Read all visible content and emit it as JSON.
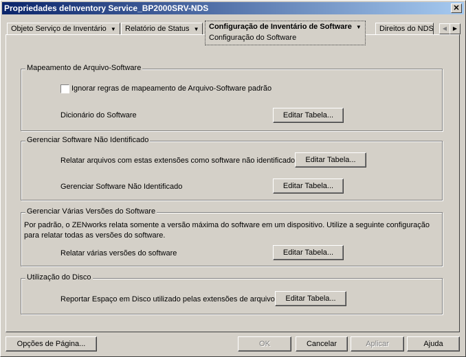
{
  "window": {
    "title": "Propriedades deInventory Service_BP2000SRV-NDS",
    "close": "✕"
  },
  "tabs": [
    {
      "label": "Objeto Serviço de Inventário"
    },
    {
      "label": "Relatório de Status"
    },
    {
      "label": "Configuração de Inventário de Software",
      "sub": "Configuração do Software"
    },
    {
      "label": "Direitos do NDS"
    }
  ],
  "tab_scroll": {
    "left": "◀",
    "right": "▶"
  },
  "dropdown_arrow": "▼",
  "groups": {
    "mapping": {
      "title": "Mapeamento de Arquivo-Software",
      "checkbox_label": "Ignorar regras de mapeamento de Arquivo-Software padrão",
      "checkbox_checked": false,
      "dict_label": "Dicionário do Software",
      "button": "Editar Tabela..."
    },
    "unidentified": {
      "title": "Gerenciar Software Não Identificado",
      "row1_label": "Relatar arquivos com estas extensões como software não identificado",
      "row1_button": "Editar Tabela...",
      "row2_label": "Gerenciar Software Não Identificado",
      "row2_button": "Editar Tabela..."
    },
    "versions": {
      "title": "Gerenciar Várias Versões do Software",
      "desc1": "Por padrão, o ZENworks relata somente a versão máxima do software em um dispositivo. Utilize a seguinte configuração",
      "desc2": "para relatar todas as versões do software.",
      "row_label": "Relatar várias versões do software",
      "button": "Editar Tabela..."
    },
    "disk": {
      "title": "Utilização do Disco",
      "row_label": "Reportar Espaço em Disco utilizado pelas extensões de arquivos",
      "button": "Editar Tabela..."
    }
  },
  "footer": {
    "page_options": "Opções de Página...",
    "ok": "OK",
    "cancel": "Cancelar",
    "apply": "Aplicar",
    "help": "Ajuda"
  }
}
